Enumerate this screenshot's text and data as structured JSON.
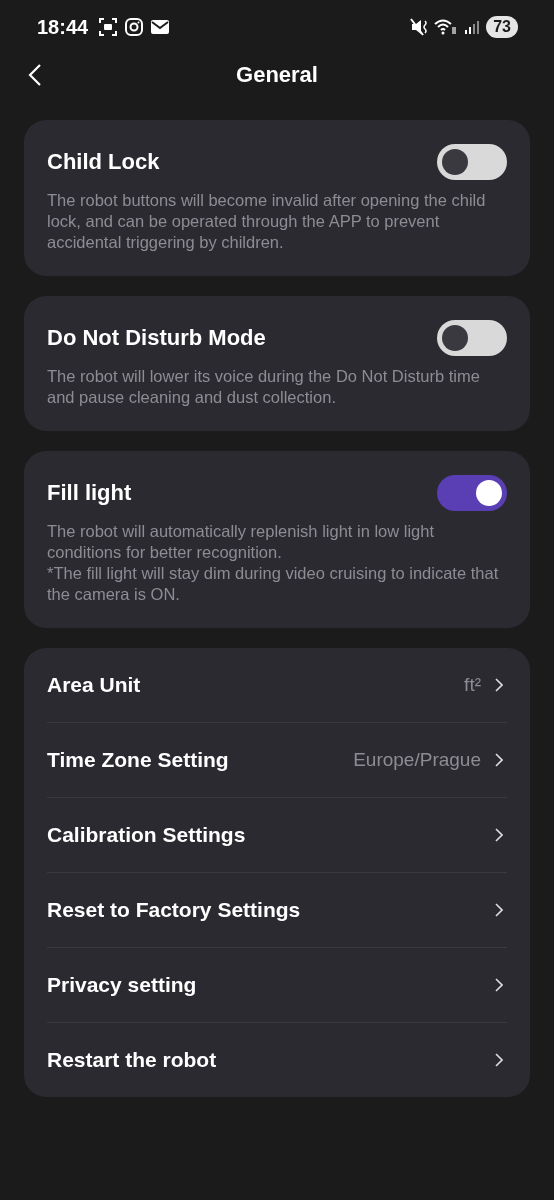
{
  "status_bar": {
    "time": "18:44",
    "battery": "73"
  },
  "header": {
    "title": "General"
  },
  "toggle_cards": [
    {
      "title": "Child Lock",
      "on": false,
      "description": "The robot buttons will become invalid after opening the child lock, and can be operated through the APP to prevent accidental triggering by children."
    },
    {
      "title": "Do Not Disturb Mode",
      "on": false,
      "description": "The robot will lower its voice during the Do Not Disturb time and pause cleaning and dust collection."
    },
    {
      "title": "Fill light",
      "on": true,
      "description": "The robot will automatically replenish light in low light conditions for better recognition.\n*The fill light will stay dim during video cruising to indicate that the camera is ON."
    }
  ],
  "settings": [
    {
      "label": "Area Unit",
      "value": "ft²"
    },
    {
      "label": "Time Zone Setting",
      "value": "Europe/Prague"
    },
    {
      "label": "Calibration Settings"
    },
    {
      "label": "Reset to Factory Settings"
    },
    {
      "label": "Privacy setting"
    },
    {
      "label": "Restart the robot"
    }
  ]
}
